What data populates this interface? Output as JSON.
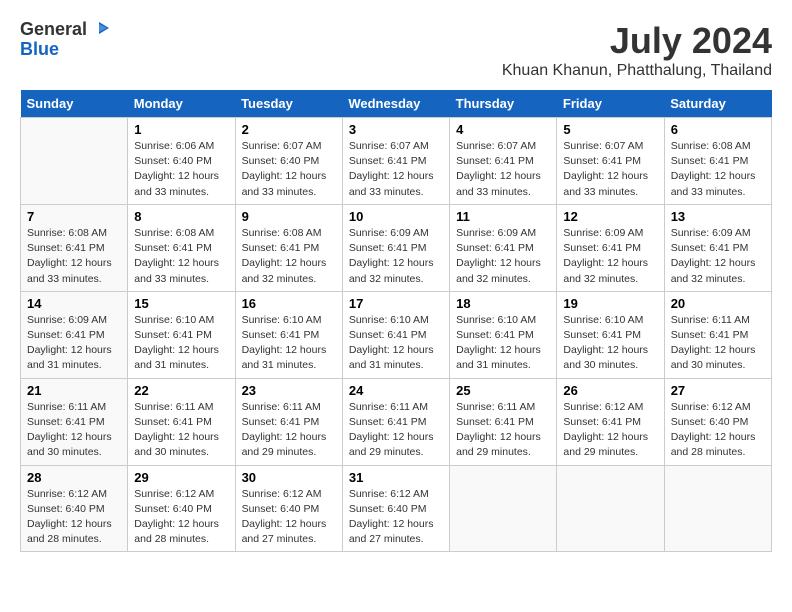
{
  "header": {
    "logo_line1": "General",
    "logo_line2": "Blue",
    "month_year": "July 2024",
    "location": "Khuan Khanun, Phatthalung, Thailand"
  },
  "days_of_week": [
    "Sunday",
    "Monday",
    "Tuesday",
    "Wednesday",
    "Thursday",
    "Friday",
    "Saturday"
  ],
  "weeks": [
    [
      {
        "day": "",
        "info": ""
      },
      {
        "day": "1",
        "info": "Sunrise: 6:06 AM\nSunset: 6:40 PM\nDaylight: 12 hours\nand 33 minutes."
      },
      {
        "day": "2",
        "info": "Sunrise: 6:07 AM\nSunset: 6:40 PM\nDaylight: 12 hours\nand 33 minutes."
      },
      {
        "day": "3",
        "info": "Sunrise: 6:07 AM\nSunset: 6:41 PM\nDaylight: 12 hours\nand 33 minutes."
      },
      {
        "day": "4",
        "info": "Sunrise: 6:07 AM\nSunset: 6:41 PM\nDaylight: 12 hours\nand 33 minutes."
      },
      {
        "day": "5",
        "info": "Sunrise: 6:07 AM\nSunset: 6:41 PM\nDaylight: 12 hours\nand 33 minutes."
      },
      {
        "day": "6",
        "info": "Sunrise: 6:08 AM\nSunset: 6:41 PM\nDaylight: 12 hours\nand 33 minutes."
      }
    ],
    [
      {
        "day": "7",
        "info": "Sunrise: 6:08 AM\nSunset: 6:41 PM\nDaylight: 12 hours\nand 33 minutes."
      },
      {
        "day": "8",
        "info": "Sunrise: 6:08 AM\nSunset: 6:41 PM\nDaylight: 12 hours\nand 33 minutes."
      },
      {
        "day": "9",
        "info": "Sunrise: 6:08 AM\nSunset: 6:41 PM\nDaylight: 12 hours\nand 32 minutes."
      },
      {
        "day": "10",
        "info": "Sunrise: 6:09 AM\nSunset: 6:41 PM\nDaylight: 12 hours\nand 32 minutes."
      },
      {
        "day": "11",
        "info": "Sunrise: 6:09 AM\nSunset: 6:41 PM\nDaylight: 12 hours\nand 32 minutes."
      },
      {
        "day": "12",
        "info": "Sunrise: 6:09 AM\nSunset: 6:41 PM\nDaylight: 12 hours\nand 32 minutes."
      },
      {
        "day": "13",
        "info": "Sunrise: 6:09 AM\nSunset: 6:41 PM\nDaylight: 12 hours\nand 32 minutes."
      }
    ],
    [
      {
        "day": "14",
        "info": "Sunrise: 6:09 AM\nSunset: 6:41 PM\nDaylight: 12 hours\nand 31 minutes."
      },
      {
        "day": "15",
        "info": "Sunrise: 6:10 AM\nSunset: 6:41 PM\nDaylight: 12 hours\nand 31 minutes."
      },
      {
        "day": "16",
        "info": "Sunrise: 6:10 AM\nSunset: 6:41 PM\nDaylight: 12 hours\nand 31 minutes."
      },
      {
        "day": "17",
        "info": "Sunrise: 6:10 AM\nSunset: 6:41 PM\nDaylight: 12 hours\nand 31 minutes."
      },
      {
        "day": "18",
        "info": "Sunrise: 6:10 AM\nSunset: 6:41 PM\nDaylight: 12 hours\nand 31 minutes."
      },
      {
        "day": "19",
        "info": "Sunrise: 6:10 AM\nSunset: 6:41 PM\nDaylight: 12 hours\nand 30 minutes."
      },
      {
        "day": "20",
        "info": "Sunrise: 6:11 AM\nSunset: 6:41 PM\nDaylight: 12 hours\nand 30 minutes."
      }
    ],
    [
      {
        "day": "21",
        "info": "Sunrise: 6:11 AM\nSunset: 6:41 PM\nDaylight: 12 hours\nand 30 minutes."
      },
      {
        "day": "22",
        "info": "Sunrise: 6:11 AM\nSunset: 6:41 PM\nDaylight: 12 hours\nand 30 minutes."
      },
      {
        "day": "23",
        "info": "Sunrise: 6:11 AM\nSunset: 6:41 PM\nDaylight: 12 hours\nand 29 minutes."
      },
      {
        "day": "24",
        "info": "Sunrise: 6:11 AM\nSunset: 6:41 PM\nDaylight: 12 hours\nand 29 minutes."
      },
      {
        "day": "25",
        "info": "Sunrise: 6:11 AM\nSunset: 6:41 PM\nDaylight: 12 hours\nand 29 minutes."
      },
      {
        "day": "26",
        "info": "Sunrise: 6:12 AM\nSunset: 6:41 PM\nDaylight: 12 hours\nand 29 minutes."
      },
      {
        "day": "27",
        "info": "Sunrise: 6:12 AM\nSunset: 6:40 PM\nDaylight: 12 hours\nand 28 minutes."
      }
    ],
    [
      {
        "day": "28",
        "info": "Sunrise: 6:12 AM\nSunset: 6:40 PM\nDaylight: 12 hours\nand 28 minutes."
      },
      {
        "day": "29",
        "info": "Sunrise: 6:12 AM\nSunset: 6:40 PM\nDaylight: 12 hours\nand 28 minutes."
      },
      {
        "day": "30",
        "info": "Sunrise: 6:12 AM\nSunset: 6:40 PM\nDaylight: 12 hours\nand 27 minutes."
      },
      {
        "day": "31",
        "info": "Sunrise: 6:12 AM\nSunset: 6:40 PM\nDaylight: 12 hours\nand 27 minutes."
      },
      {
        "day": "",
        "info": ""
      },
      {
        "day": "",
        "info": ""
      },
      {
        "day": "",
        "info": ""
      }
    ]
  ]
}
